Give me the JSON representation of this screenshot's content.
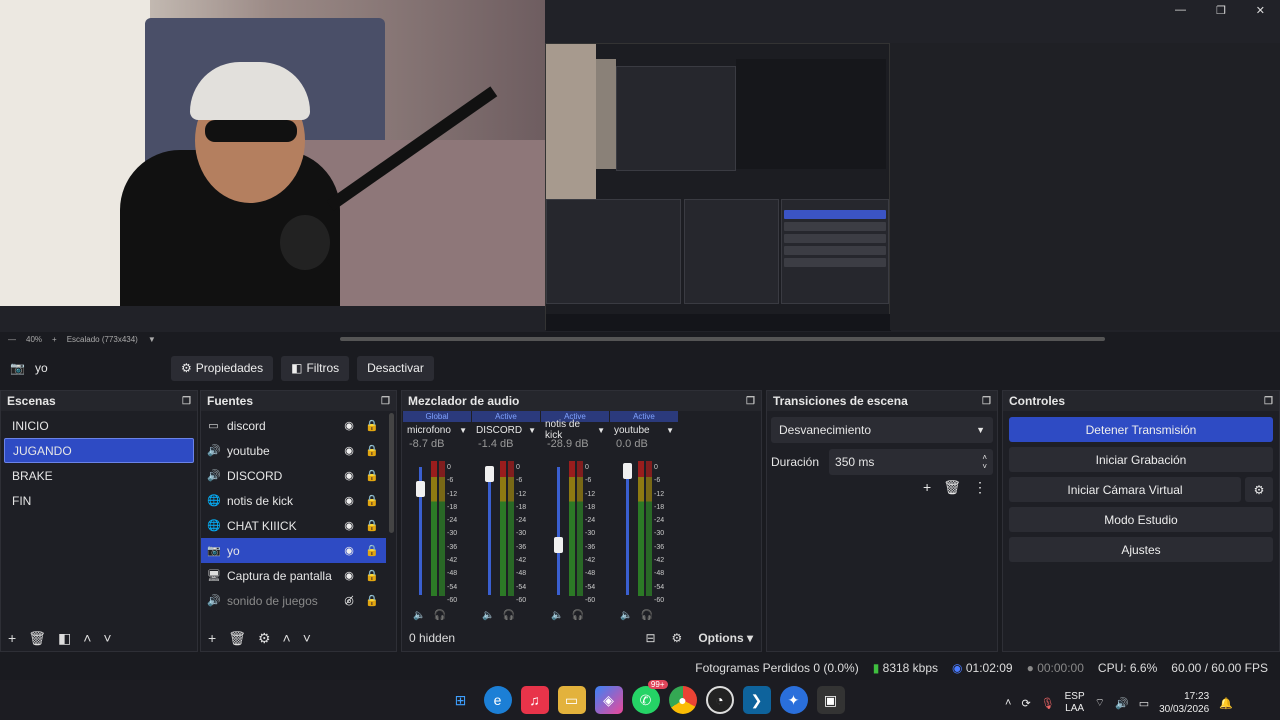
{
  "window": {
    "min": "—",
    "max": "❐",
    "close": "✕"
  },
  "preview": {
    "zoom": "40%",
    "scale": "Escalado (773x434)"
  },
  "toolbar": {
    "source": "yo",
    "properties": "Propiedades",
    "filters": "Filtros",
    "deactivate": "Desactivar"
  },
  "scenes": {
    "title": "Escenas",
    "items": [
      "INICIO",
      "JUGANDO",
      "BRAKE",
      "FIN"
    ],
    "selected": "JUGANDO"
  },
  "sources": {
    "title": "Fuentes",
    "items": [
      {
        "name": "discord",
        "icon": "window-icon"
      },
      {
        "name": "youtube",
        "icon": "audio-icon"
      },
      {
        "name": "DISCORD",
        "icon": "audio-icon"
      },
      {
        "name": "notis de kick",
        "icon": "globe-icon"
      },
      {
        "name": "CHAT KIIICK",
        "icon": "globe-icon"
      },
      {
        "name": "yo",
        "icon": "camera-icon"
      },
      {
        "name": "Captura de pantalla",
        "icon": "monitor-icon"
      },
      {
        "name": "sonido de juegos",
        "icon": "audio-icon"
      }
    ]
  },
  "mixer": {
    "title": "Mezclador de audio",
    "hidden": "0 hidden",
    "options": "Options",
    "scale": [
      "0",
      "-6",
      "-12",
      "-18",
      "-24",
      "-30",
      "-36",
      "-42",
      "-48",
      "-54",
      "-60"
    ],
    "channels": [
      {
        "tag": "Global",
        "name": "microfono",
        "db": "-8.7 dB",
        "level": 0.88
      },
      {
        "tag": "Active",
        "name": "DISCORD",
        "db": "-1.4 dB",
        "level": 0.98
      },
      {
        "tag": "Active",
        "name": "notis de kick",
        "db": "-28.9 dB",
        "level": 0.52
      },
      {
        "tag": "Active",
        "name": "youtube",
        "db": "0.0 dB",
        "level": 1.0
      }
    ]
  },
  "transitions": {
    "title": "Transiciones de escena",
    "type": "Desvanecimiento",
    "duration_label": "Duración",
    "duration": "350 ms"
  },
  "controls": {
    "title": "Controles",
    "buttons": [
      "Detener Transmisión",
      "Iniciar Grabación",
      "Iniciar Cámara Virtual",
      "Modo Estudio",
      "Ajustes"
    ]
  },
  "status": {
    "dropped": "Fotogramas Perdidos 0 (0.0%)",
    "kbps": "8318 kbps",
    "live": "01:02:09",
    "rec": "00:00:00",
    "cpu": "CPU: 6.6%",
    "fps": "60.00 / 60.00 FPS"
  },
  "taskbar": {
    "badge": "99+",
    "lang": "ESP",
    "layout": "LAA",
    "time": "17:23",
    "date": "30/03/2026"
  },
  "colors": {
    "accent": "#2e4bc4",
    "bg": "#1a1b20"
  }
}
